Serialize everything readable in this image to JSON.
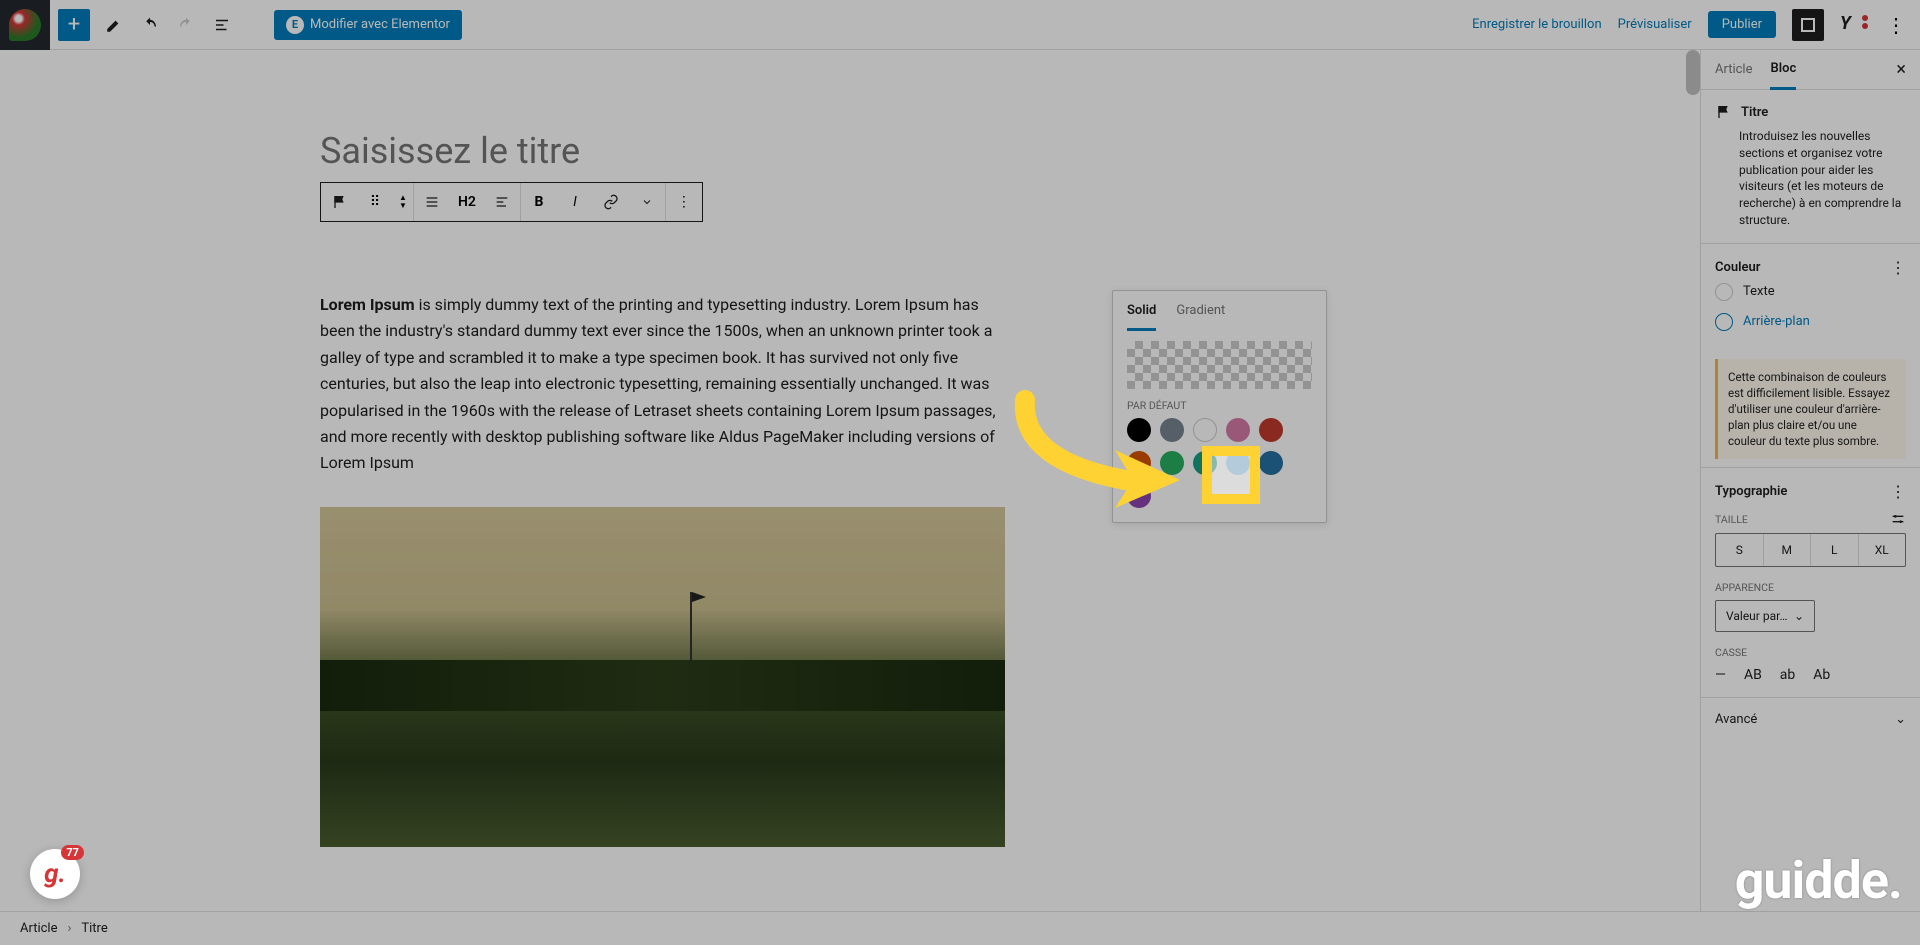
{
  "topbar": {
    "elementor_label": "Modifier avec Elementor",
    "save_draft": "Enregistrer le brouillon",
    "preview": "Prévisualiser",
    "publish": "Publier"
  },
  "editor": {
    "title_placeholder": "Saisissez le titre",
    "heading_level": "H2",
    "paragraph_bold": "Lorem Ipsum",
    "paragraph_rest": " is simply dummy text of the printing and typesetting industry. Lorem Ipsum has been the industry's standard dummy text ever since the 1500s, when an unknown printer took a galley of type and scrambled it to make a type specimen book. It has survived not only five centuries, but also the leap into electronic typesetting, remaining essentially unchanged. It was popularised in the 1960s with the release of Letraset sheets containing Lorem Ipsum passages, and more recently with desktop publishing software like Aldus PageMaker including versions of Lorem Ipsum"
  },
  "sidebar": {
    "tab_article": "Article",
    "tab_bloc": "Bloc",
    "block_title": "Titre",
    "block_desc": "Introduisez les nouvelles sections et organisez votre publication pour aider les visiteurs (et les moteurs de recherche) à en comprendre la structure.",
    "couleur": "Couleur",
    "texte": "Texte",
    "arriere_plan": "Arrière-plan",
    "warning": "Cette combinaison de couleurs est difficilement lisible. Essayez d'utiliser une couleur d'arrière-plan plus claire et/ou une couleur du texte plus sombre.",
    "typo": "Typographie",
    "taille": "TAILLE",
    "sizes": [
      "S",
      "M",
      "L",
      "XL"
    ],
    "apparence": "APPARENCE",
    "apparence_val": "Valeur par…",
    "casse": "CASSE",
    "case_opts": [
      "—",
      "AB",
      "ab",
      "Ab"
    ],
    "avance": "Avancé"
  },
  "popover": {
    "solid": "Solid",
    "gradient": "Gradient",
    "par_defaut": "PAR DÉFAUT",
    "colors": [
      {
        "hex": "#000000"
      },
      {
        "hex": "#78848f"
      },
      {
        "hex": "#ffffff",
        "white": true
      },
      {
        "hex": "#d67ba8"
      },
      {
        "hex": "#c0392b"
      },
      {
        "hex": "#d35400"
      },
      {
        "hex": "#27ae60"
      },
      {
        "hex": "#16a085"
      },
      {
        "hex": "#8ed1fc",
        "highlight": true
      },
      {
        "hex": "#2471a3"
      },
      {
        "hex": "#8e44ad"
      }
    ]
  },
  "footer": {
    "crumb1": "Article",
    "crumb2": "Titre"
  },
  "annotations": {
    "guidde": "guidde.",
    "badge_count": "77"
  }
}
